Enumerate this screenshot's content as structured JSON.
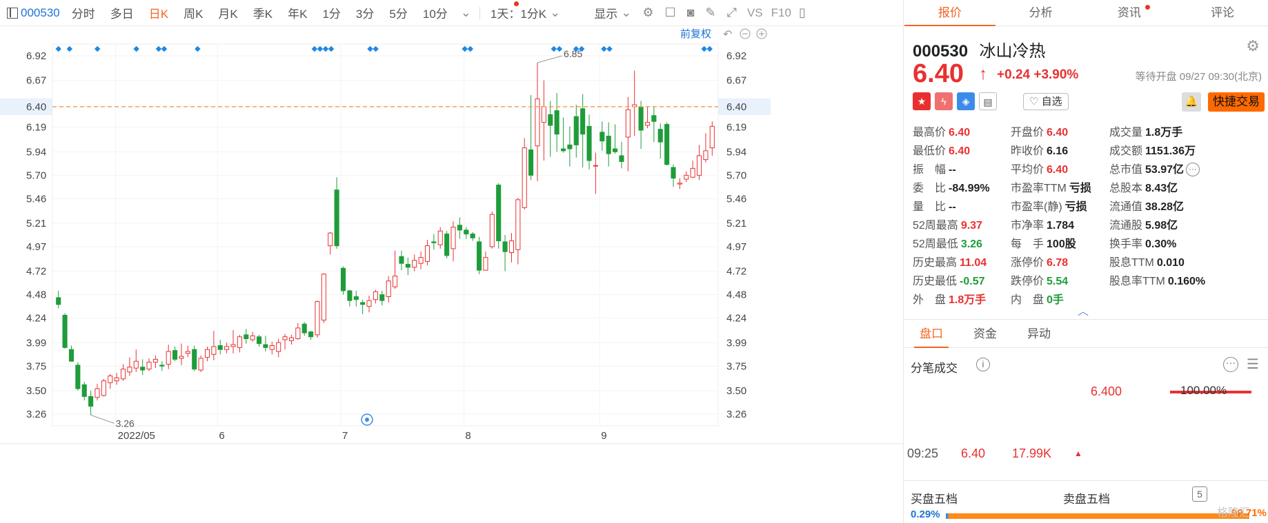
{
  "toolbar": {
    "code": "000530",
    "tabs": [
      "分时",
      "多日",
      "日K",
      "周K",
      "月K",
      "季K",
      "年K",
      "1分",
      "3分",
      "5分",
      "10分"
    ],
    "active_tab": "日K",
    "period_select": "1天：1分K",
    "display_label": "显示",
    "vs_label": "VS",
    "f10_label": "F10"
  },
  "chart": {
    "adjust_label": "前复权",
    "y_ticks": [
      "6.92",
      "6.67",
      "6.40",
      "6.19",
      "5.94",
      "5.70",
      "5.46",
      "5.21",
      "4.97",
      "4.72",
      "4.48",
      "4.24",
      "3.99",
      "3.75",
      "3.50",
      "3.26"
    ],
    "current_price_label": "6.40",
    "x_labels": [
      "2022/05",
      "6",
      "7",
      "8",
      "9"
    ],
    "max_label": "6.85",
    "min_label": "3.26",
    "colors": {
      "up": "#e93030",
      "down": "#1f9c3a",
      "price_line": "#f5a05a",
      "marker": "#1e88e5"
    }
  },
  "chart_data": {
    "type": "candlestick",
    "ylim": [
      3.14,
      7.04
    ],
    "y_ticks": [
      6.92,
      6.67,
      6.4,
      6.19,
      5.94,
      5.7,
      5.46,
      5.21,
      4.97,
      4.72,
      4.48,
      4.24,
      3.99,
      3.75,
      3.5,
      3.26
    ],
    "current_price": 6.4,
    "high_annotation": 6.85,
    "low_annotation": 3.26,
    "x_labels": [
      "2022/05",
      "6",
      "7",
      "8",
      "9"
    ],
    "candles": [
      [
        4.45,
        4.38,
        4.52,
        4.34
      ],
      [
        4.27,
        3.94,
        4.29,
        3.93
      ],
      [
        3.92,
        3.8,
        3.96,
        3.8
      ],
      [
        3.76,
        3.52,
        3.79,
        3.5
      ],
      [
        3.56,
        3.44,
        3.59,
        3.4
      ],
      [
        3.44,
        3.34,
        3.5,
        3.25
      ],
      [
        3.43,
        3.52,
        3.57,
        3.4
      ],
      [
        3.45,
        3.6,
        3.62,
        3.44
      ],
      [
        3.58,
        3.65,
        3.67,
        3.52
      ],
      [
        3.6,
        3.63,
        3.68,
        3.56
      ],
      [
        3.62,
        3.72,
        3.77,
        3.6
      ],
      [
        3.69,
        3.74,
        3.84,
        3.65
      ],
      [
        3.73,
        3.8,
        3.92,
        3.69
      ],
      [
        3.74,
        3.71,
        3.82,
        3.66
      ],
      [
        3.72,
        3.79,
        3.83,
        3.7
      ],
      [
        3.79,
        3.82,
        3.86,
        3.73
      ],
      [
        3.76,
        3.75,
        3.8,
        3.7
      ],
      [
        3.77,
        3.9,
        3.97,
        3.72
      ],
      [
        3.91,
        3.82,
        3.95,
        3.8
      ],
      [
        3.83,
        3.85,
        3.98,
        3.76
      ],
      [
        3.88,
        3.9,
        3.96,
        3.84
      ],
      [
        3.92,
        3.72,
        3.96,
        3.7
      ],
      [
        3.71,
        3.83,
        3.86,
        3.69
      ],
      [
        3.84,
        3.92,
        3.95,
        3.8
      ],
      [
        3.87,
        3.95,
        4.11,
        3.81
      ],
      [
        3.96,
        3.92,
        4.02,
        3.87
      ],
      [
        3.92,
        3.95,
        3.99,
        3.88
      ],
      [
        3.95,
        3.97,
        4.12,
        3.88
      ],
      [
        3.94,
        4.05,
        4.07,
        3.89
      ],
      [
        4.07,
        4.03,
        4.13,
        3.98
      ],
      [
        4.02,
        4.06,
        4.1,
        4.0
      ],
      [
        4.05,
        3.98,
        4.07,
        3.95
      ],
      [
        3.97,
        3.94,
        4.06,
        3.9
      ],
      [
        3.92,
        3.96,
        4.0,
        3.87
      ],
      [
        3.9,
        3.99,
        4.03,
        3.84
      ],
      [
        4.02,
        4.05,
        4.08,
        3.92
      ],
      [
        4.01,
        4.04,
        4.07,
        3.97
      ],
      [
        4.03,
        4.14,
        4.19,
        4.02
      ],
      [
        4.18,
        4.09,
        4.2,
        4.06
      ],
      [
        4.1,
        4.05,
        4.11,
        4.02
      ],
      [
        4.07,
        4.41,
        4.42,
        4.04
      ],
      [
        4.22,
        4.69,
        4.7,
        4.19
      ],
      [
        4.98,
        5.11,
        5.12,
        4.89
      ],
      [
        5.55,
        4.98,
        5.68,
        4.95
      ],
      [
        4.75,
        4.52,
        4.77,
        4.48
      ],
      [
        4.52,
        4.42,
        4.53,
        4.36
      ],
      [
        4.46,
        4.43,
        4.52,
        4.36
      ],
      [
        4.4,
        4.38,
        4.43,
        4.28
      ],
      [
        4.36,
        4.42,
        4.47,
        4.3
      ],
      [
        4.43,
        4.51,
        4.53,
        4.39
      ],
      [
        4.48,
        4.42,
        4.52,
        4.37
      ],
      [
        4.46,
        4.62,
        4.67,
        4.4
      ],
      [
        4.56,
        4.67,
        4.93,
        4.54
      ],
      [
        4.87,
        4.8,
        4.93,
        4.73
      ],
      [
        4.79,
        4.76,
        4.86,
        4.68
      ],
      [
        4.76,
        4.83,
        4.89,
        4.72
      ],
      [
        4.8,
        4.86,
        4.92,
        4.74
      ],
      [
        4.82,
        4.98,
        5.04,
        4.78
      ],
      [
        5.02,
        5.01,
        5.1,
        4.94
      ],
      [
        4.99,
        5.13,
        5.17,
        4.95
      ],
      [
        5.1,
        4.88,
        5.13,
        4.85
      ],
      [
        4.95,
        5.17,
        5.23,
        4.82
      ],
      [
        5.19,
        5.14,
        5.27,
        5.05
      ],
      [
        5.14,
        5.1,
        5.17,
        5.05
      ],
      [
        5.1,
        5.06,
        5.12,
        5.03
      ],
      [
        5.02,
        4.73,
        5.07,
        4.69
      ],
      [
        4.73,
        4.86,
        4.92,
        4.73
      ],
      [
        4.97,
        5.3,
        5.33,
        4.95
      ],
      [
        5.6,
        5.03,
        5.62,
        4.95
      ],
      [
        5.02,
        4.92,
        5.09,
        4.72
      ],
      [
        4.91,
        5.03,
        5.11,
        4.81
      ],
      [
        4.94,
        5.45,
        5.47,
        4.79
      ],
      [
        5.37,
        5.98,
        6.08,
        5.35
      ],
      [
        5.96,
        5.7,
        6.52,
        5.65
      ],
      [
        6.0,
        6.48,
        6.85,
        5.64
      ],
      [
        6.24,
        6.4,
        6.67,
        5.85
      ],
      [
        6.32,
        6.21,
        6.46,
        5.89
      ],
      [
        6.36,
        6.12,
        6.54,
        5.94
      ],
      [
        5.97,
        5.95,
        6.29,
        5.93
      ],
      [
        6.01,
        5.97,
        6.2,
        5.79
      ],
      [
        6.3,
        6.01,
        6.42,
        5.88
      ],
      [
        6.38,
        6.12,
        6.53,
        5.78
      ],
      [
        6.2,
        5.85,
        6.32,
        5.76
      ],
      [
        5.8,
        5.8,
        5.93,
        5.51
      ],
      [
        6.14,
        6.05,
        6.25,
        5.95
      ],
      [
        6.1,
        5.92,
        6.24,
        5.79
      ],
      [
        5.97,
        5.94,
        6.22,
        5.92
      ],
      [
        5.9,
        5.84,
        6.04,
        5.77
      ],
      [
        6.09,
        6.37,
        6.5,
        5.74
      ],
      [
        6.4,
        6.42,
        6.77,
        6.1
      ],
      [
        6.4,
        6.16,
        6.46,
        5.97
      ],
      [
        6.21,
        6.24,
        6.4,
        6.18
      ],
      [
        6.31,
        6.25,
        6.4,
        6.04
      ],
      [
        6.17,
        6.04,
        6.23,
        5.87
      ],
      [
        6.22,
        5.81,
        6.24,
        5.8
      ],
      [
        5.78,
        5.67,
        5.81,
        5.58
      ],
      [
        5.61,
        5.62,
        5.67,
        5.56
      ],
      [
        5.66,
        5.7,
        5.74,
        5.63
      ],
      [
        5.68,
        5.77,
        5.85,
        5.67
      ],
      [
        5.7,
        5.9,
        6.01,
        5.65
      ],
      [
        5.86,
        5.95,
        6.13,
        5.83
      ],
      [
        5.98,
        6.2,
        6.25,
        5.9
      ]
    ]
  },
  "tabs": {
    "items": [
      "报价",
      "分析",
      "资讯",
      "评论"
    ],
    "active": "报价"
  },
  "stock": {
    "code": "000530",
    "name": "冰山冷热",
    "price": "6.40",
    "change": "+0.24 +3.90%",
    "status": "等待开盘 09/27 09:30(北京)",
    "watch_label": "自选",
    "fast_trade_label": "快捷交易",
    "up_color": "#e93030",
    "down_color": "#1f9c3a",
    "accent_color": "#f26522"
  },
  "quote": {
    "rows": [
      [
        {
          "label": "最高价",
          "value": "6.40",
          "color": "red"
        },
        {
          "label": "开盘价",
          "value": "6.40",
          "color": "red"
        },
        {
          "label": "成交量",
          "value": "1.8万手",
          "color": ""
        }
      ],
      [
        {
          "label": "最低价",
          "value": "6.40",
          "color": "red"
        },
        {
          "label": "昨收价",
          "value": "6.16",
          "color": ""
        },
        {
          "label": "成交额",
          "value": "1151.36万",
          "color": ""
        }
      ],
      [
        {
          "label": "振　幅",
          "value": "--",
          "color": ""
        },
        {
          "label": "平均价",
          "value": "6.40",
          "color": "red"
        },
        {
          "label": "总市值",
          "value": "53.97亿",
          "color": ""
        }
      ],
      [
        {
          "label": "委　比",
          "value": "-84.99%",
          "color": ""
        },
        {
          "label": "市盈率TTM",
          "value": "亏损",
          "color": ""
        },
        {
          "label": "总股本",
          "value": "8.43亿",
          "color": ""
        }
      ],
      [
        {
          "label": "量　比",
          "value": "--",
          "color": ""
        },
        {
          "label": "市盈率(静)",
          "value": "亏损",
          "color": ""
        },
        {
          "label": "流通值",
          "value": "38.28亿",
          "color": ""
        }
      ],
      [
        {
          "label": "52周最高",
          "value": "9.37",
          "color": "red"
        },
        {
          "label": "市净率",
          "value": "1.784",
          "color": ""
        },
        {
          "label": "流通股",
          "value": "5.98亿",
          "color": ""
        }
      ],
      [
        {
          "label": "52周最低",
          "value": "3.26",
          "color": "green"
        },
        {
          "label": "每　手",
          "value": "100股",
          "color": ""
        },
        {
          "label": "换手率",
          "value": "0.30%",
          "color": ""
        }
      ],
      [
        {
          "label": "历史最高",
          "value": "11.04",
          "color": "red"
        },
        {
          "label": "涨停价",
          "value": "6.78",
          "color": "red"
        },
        {
          "label": "股息TTM",
          "value": "0.010",
          "color": ""
        }
      ],
      [
        {
          "label": "历史最低",
          "value": "-0.57",
          "color": "green"
        },
        {
          "label": "跌停价",
          "value": "5.54",
          "color": "green"
        },
        {
          "label": "股息率TTM",
          "value": "0.160%",
          "color": ""
        }
      ],
      [
        {
          "label": "外　盘",
          "value": "1.8万手",
          "color": "red"
        },
        {
          "label": "内　盘",
          "value": "0手",
          "color": "green"
        },
        {
          "label": "",
          "value": "",
          "color": ""
        }
      ]
    ]
  },
  "sub_tabs": {
    "items": [
      "盘口",
      "资金",
      "异动"
    ],
    "active": "盘口"
  },
  "ticks": {
    "title": "分笔成交",
    "price": "6.400",
    "pct": "100.00%",
    "row": {
      "time": "09:25",
      "price": "6.40",
      "volume": "17.99K"
    }
  },
  "order_book": {
    "buy_title": "买盘五档",
    "sell_title": "卖盘五档",
    "level_count": "5",
    "buy_pct": "0.29%",
    "sell_pct": "99.71%",
    "buy_fraction": 0.0029
  },
  "watermark": "格隆汇"
}
